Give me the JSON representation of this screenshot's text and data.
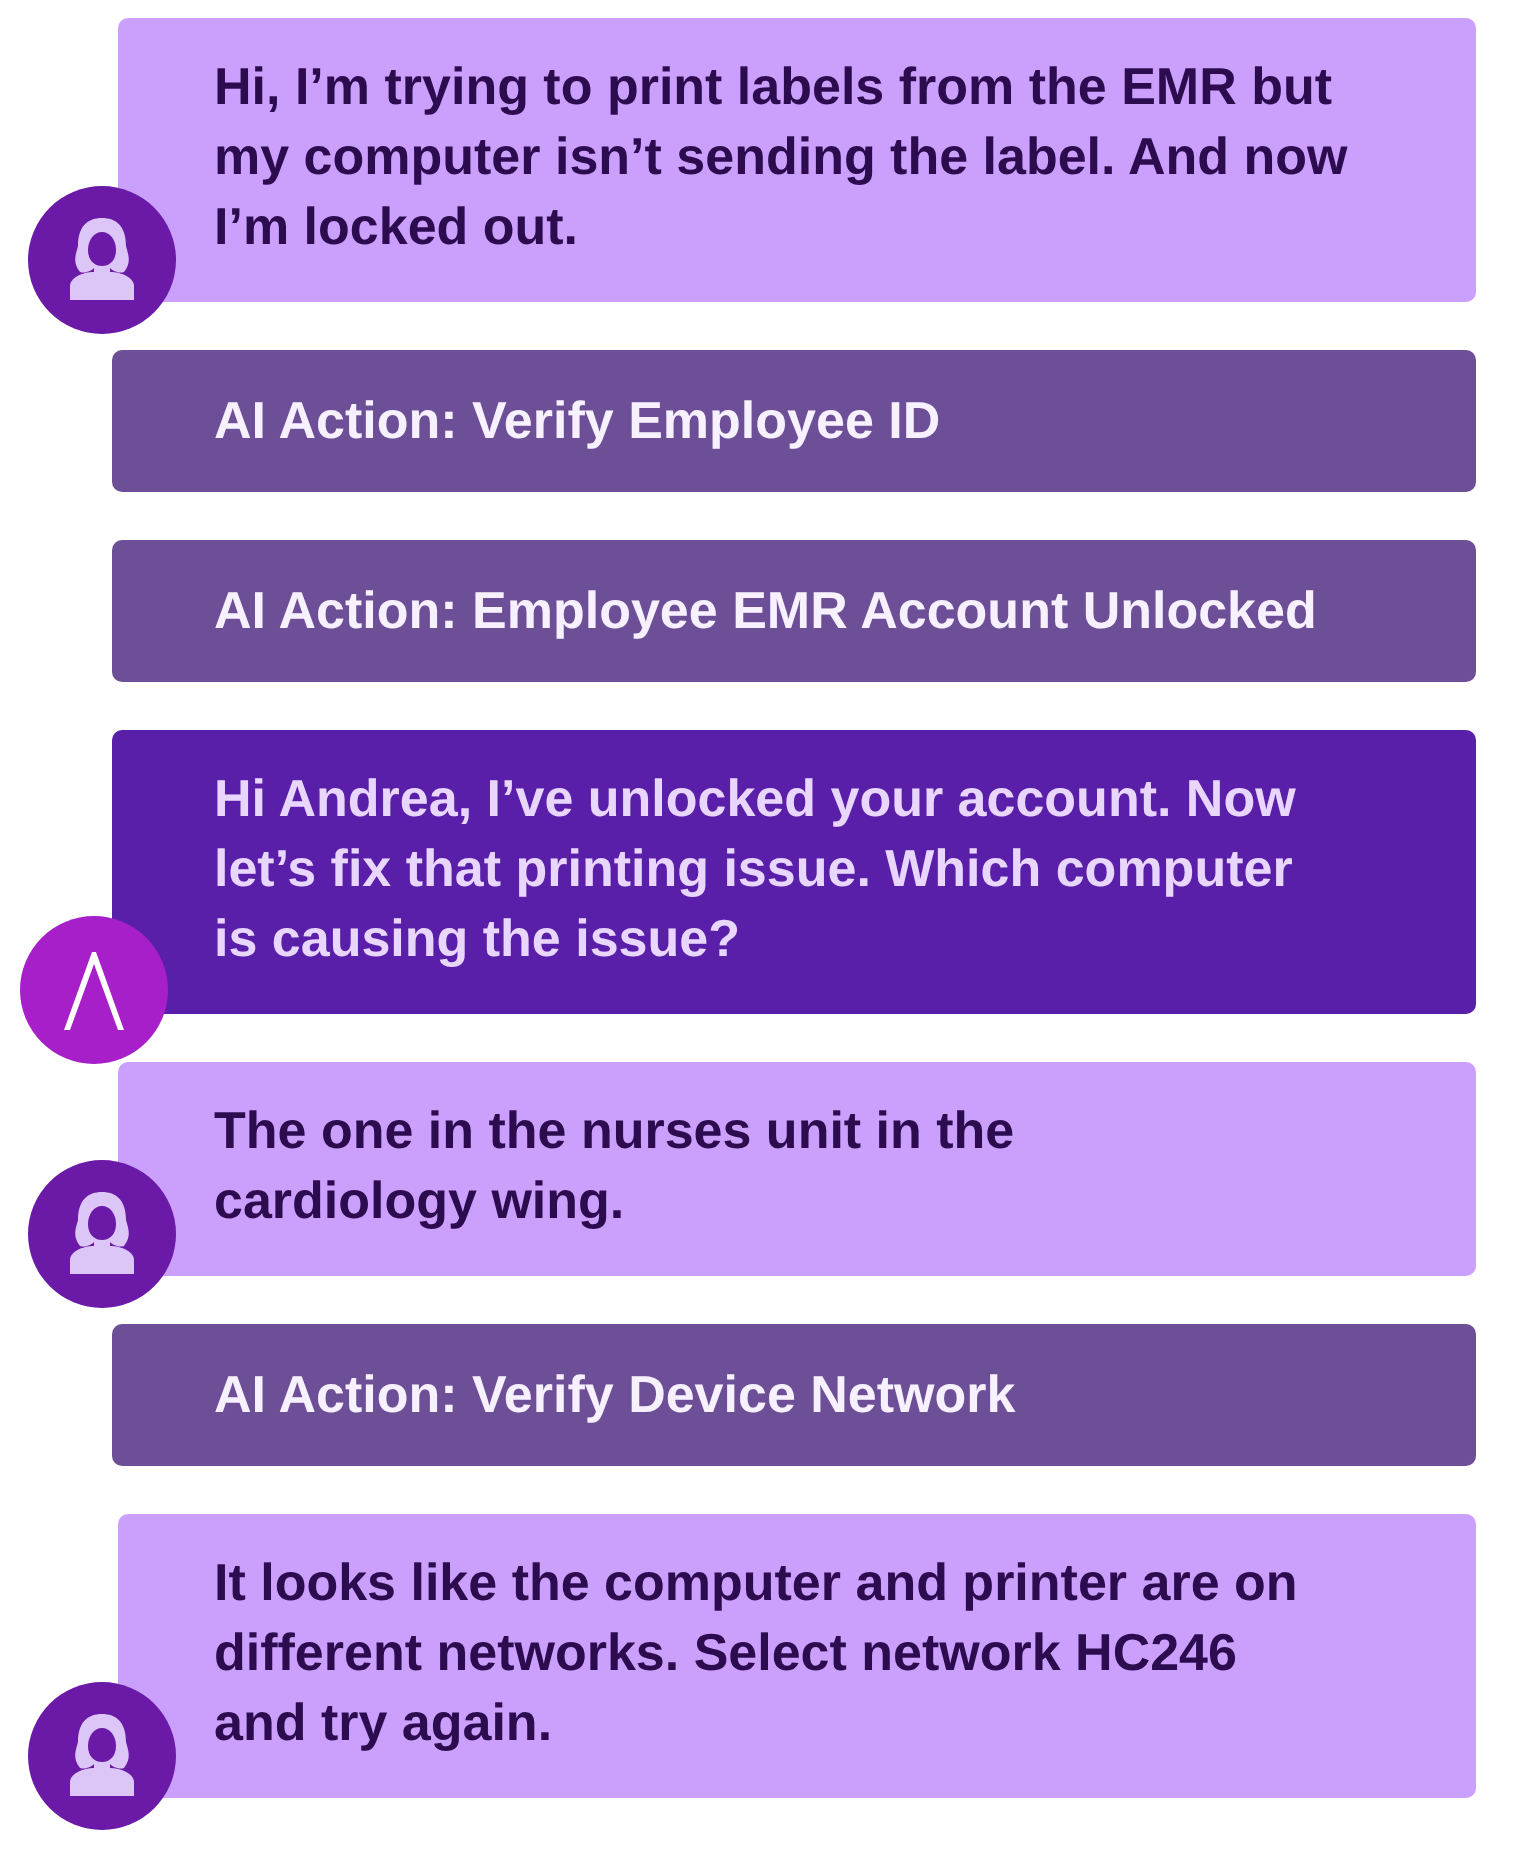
{
  "messages": [
    {
      "kind": "user",
      "text": "Hi, I’m trying to print labels from the EMR but\nmy computer isn’t sending the label. And now\nI’m locked out."
    },
    {
      "kind": "action",
      "text": "AI Action: Verify Employee ID"
    },
    {
      "kind": "action",
      "text": "AI Action: Employee EMR Account Unlocked"
    },
    {
      "kind": "agent",
      "text": "Hi Andrea, I’ve unlocked your account. Now\nlet’s fix that printing issue. Which computer\nis causing the issue?"
    },
    {
      "kind": "user",
      "text": "The one in the nurses unit in the\ncardiology wing."
    },
    {
      "kind": "action",
      "text": "AI Action: Verify Device Network"
    },
    {
      "kind": "user",
      "text": "It looks like the computer and printer are on\ndifferent networks. Select network HC246\nand try again."
    }
  ]
}
